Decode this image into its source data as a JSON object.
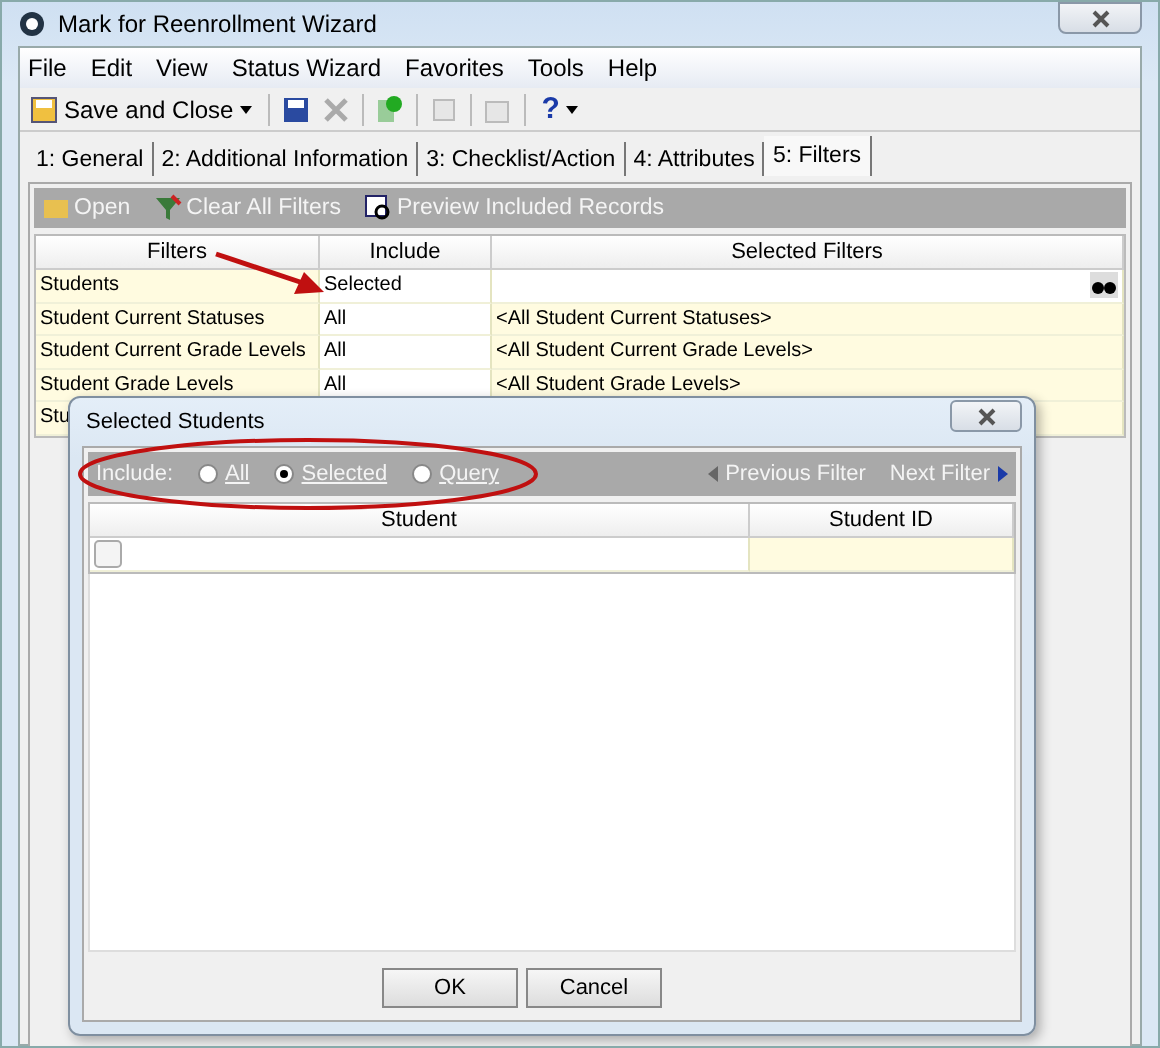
{
  "window": {
    "title": "Mark for Reenrollment Wizard"
  },
  "menu": [
    "File",
    "Edit",
    "View",
    "Status Wizard",
    "Favorites",
    "Tools",
    "Help"
  ],
  "toolbar": {
    "save_label": "Save and Close",
    "help_label": "?"
  },
  "tabs": [
    {
      "label": "1: General",
      "selected": false
    },
    {
      "label": "2: Additional Information",
      "selected": false
    },
    {
      "label": "3: Checklist/Action",
      "selected": false
    },
    {
      "label": "4: Attributes",
      "selected": false
    },
    {
      "label": "5: Filters",
      "selected": true
    }
  ],
  "filter_toolbar": [
    "Open",
    "Clear All Filters",
    "Preview Included Records"
  ],
  "table": {
    "columns": [
      "Filters",
      "Include",
      "Selected Filters"
    ],
    "rows": [
      {
        "filter": "Students",
        "include": "Selected",
        "selected_filters": "",
        "search": true
      },
      {
        "filter": "Student Current Statuses",
        "include": "All",
        "selected_filters": "<All Student Current Statuses>",
        "search": false
      },
      {
        "filter": "Student Current Grade Levels",
        "include": "All",
        "selected_filters": "<All Student Current Grade Levels>",
        "search": false
      },
      {
        "filter": "Student Grade Levels",
        "include": "All",
        "selected_filters": "<All Student Grade Levels>",
        "search": false
      },
      {
        "filter": "Stu",
        "include": "",
        "selected_filters": "",
        "search": false
      }
    ]
  },
  "dialog": {
    "title": "Selected Students",
    "include_label": "Include:",
    "options": [
      {
        "label": "All",
        "selected": false
      },
      {
        "label": "Selected",
        "selected": true
      },
      {
        "label": "Query",
        "selected": false
      }
    ],
    "previous": "Previous Filter",
    "next": "Next Filter",
    "columns": [
      "Student",
      "Student ID"
    ],
    "rows": [
      {
        "checked": false
      }
    ],
    "buttons": [
      "OK",
      "Cancel"
    ]
  }
}
